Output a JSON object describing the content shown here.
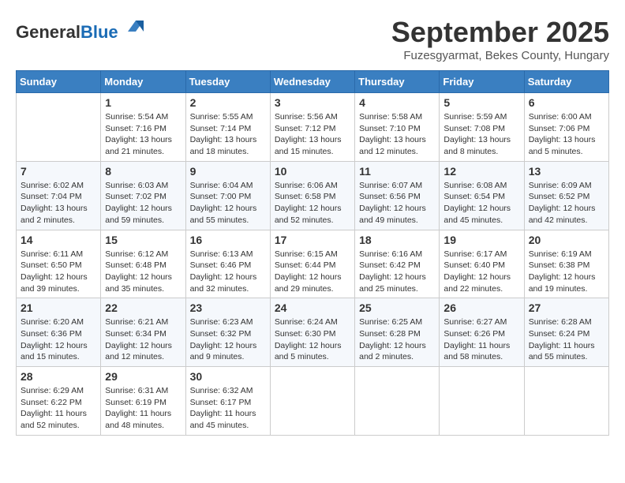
{
  "header": {
    "logo_general": "General",
    "logo_blue": "Blue",
    "month": "September 2025",
    "location": "Fuzesgyarmat, Bekes County, Hungary"
  },
  "calendar": {
    "days_of_week": [
      "Sunday",
      "Monday",
      "Tuesday",
      "Wednesday",
      "Thursday",
      "Friday",
      "Saturday"
    ],
    "weeks": [
      [
        {
          "day": "",
          "sunrise": "",
          "sunset": "",
          "daylight": ""
        },
        {
          "day": "1",
          "sunrise": "Sunrise: 5:54 AM",
          "sunset": "Sunset: 7:16 PM",
          "daylight": "Daylight: 13 hours and 21 minutes."
        },
        {
          "day": "2",
          "sunrise": "Sunrise: 5:55 AM",
          "sunset": "Sunset: 7:14 PM",
          "daylight": "Daylight: 13 hours and 18 minutes."
        },
        {
          "day": "3",
          "sunrise": "Sunrise: 5:56 AM",
          "sunset": "Sunset: 7:12 PM",
          "daylight": "Daylight: 13 hours and 15 minutes."
        },
        {
          "day": "4",
          "sunrise": "Sunrise: 5:58 AM",
          "sunset": "Sunset: 7:10 PM",
          "daylight": "Daylight: 13 hours and 12 minutes."
        },
        {
          "day": "5",
          "sunrise": "Sunrise: 5:59 AM",
          "sunset": "Sunset: 7:08 PM",
          "daylight": "Daylight: 13 hours and 8 minutes."
        },
        {
          "day": "6",
          "sunrise": "Sunrise: 6:00 AM",
          "sunset": "Sunset: 7:06 PM",
          "daylight": "Daylight: 13 hours and 5 minutes."
        }
      ],
      [
        {
          "day": "7",
          "sunrise": "Sunrise: 6:02 AM",
          "sunset": "Sunset: 7:04 PM",
          "daylight": "Daylight: 13 hours and 2 minutes."
        },
        {
          "day": "8",
          "sunrise": "Sunrise: 6:03 AM",
          "sunset": "Sunset: 7:02 PM",
          "daylight": "Daylight: 12 hours and 59 minutes."
        },
        {
          "day": "9",
          "sunrise": "Sunrise: 6:04 AM",
          "sunset": "Sunset: 7:00 PM",
          "daylight": "Daylight: 12 hours and 55 minutes."
        },
        {
          "day": "10",
          "sunrise": "Sunrise: 6:06 AM",
          "sunset": "Sunset: 6:58 PM",
          "daylight": "Daylight: 12 hours and 52 minutes."
        },
        {
          "day": "11",
          "sunrise": "Sunrise: 6:07 AM",
          "sunset": "Sunset: 6:56 PM",
          "daylight": "Daylight: 12 hours and 49 minutes."
        },
        {
          "day": "12",
          "sunrise": "Sunrise: 6:08 AM",
          "sunset": "Sunset: 6:54 PM",
          "daylight": "Daylight: 12 hours and 45 minutes."
        },
        {
          "day": "13",
          "sunrise": "Sunrise: 6:09 AM",
          "sunset": "Sunset: 6:52 PM",
          "daylight": "Daylight: 12 hours and 42 minutes."
        }
      ],
      [
        {
          "day": "14",
          "sunrise": "Sunrise: 6:11 AM",
          "sunset": "Sunset: 6:50 PM",
          "daylight": "Daylight: 12 hours and 39 minutes."
        },
        {
          "day": "15",
          "sunrise": "Sunrise: 6:12 AM",
          "sunset": "Sunset: 6:48 PM",
          "daylight": "Daylight: 12 hours and 35 minutes."
        },
        {
          "day": "16",
          "sunrise": "Sunrise: 6:13 AM",
          "sunset": "Sunset: 6:46 PM",
          "daylight": "Daylight: 12 hours and 32 minutes."
        },
        {
          "day": "17",
          "sunrise": "Sunrise: 6:15 AM",
          "sunset": "Sunset: 6:44 PM",
          "daylight": "Daylight: 12 hours and 29 minutes."
        },
        {
          "day": "18",
          "sunrise": "Sunrise: 6:16 AM",
          "sunset": "Sunset: 6:42 PM",
          "daylight": "Daylight: 12 hours and 25 minutes."
        },
        {
          "day": "19",
          "sunrise": "Sunrise: 6:17 AM",
          "sunset": "Sunset: 6:40 PM",
          "daylight": "Daylight: 12 hours and 22 minutes."
        },
        {
          "day": "20",
          "sunrise": "Sunrise: 6:19 AM",
          "sunset": "Sunset: 6:38 PM",
          "daylight": "Daylight: 12 hours and 19 minutes."
        }
      ],
      [
        {
          "day": "21",
          "sunrise": "Sunrise: 6:20 AM",
          "sunset": "Sunset: 6:36 PM",
          "daylight": "Daylight: 12 hours and 15 minutes."
        },
        {
          "day": "22",
          "sunrise": "Sunrise: 6:21 AM",
          "sunset": "Sunset: 6:34 PM",
          "daylight": "Daylight: 12 hours and 12 minutes."
        },
        {
          "day": "23",
          "sunrise": "Sunrise: 6:23 AM",
          "sunset": "Sunset: 6:32 PM",
          "daylight": "Daylight: 12 hours and 9 minutes."
        },
        {
          "day": "24",
          "sunrise": "Sunrise: 6:24 AM",
          "sunset": "Sunset: 6:30 PM",
          "daylight": "Daylight: 12 hours and 5 minutes."
        },
        {
          "day": "25",
          "sunrise": "Sunrise: 6:25 AM",
          "sunset": "Sunset: 6:28 PM",
          "daylight": "Daylight: 12 hours and 2 minutes."
        },
        {
          "day": "26",
          "sunrise": "Sunrise: 6:27 AM",
          "sunset": "Sunset: 6:26 PM",
          "daylight": "Daylight: 11 hours and 58 minutes."
        },
        {
          "day": "27",
          "sunrise": "Sunrise: 6:28 AM",
          "sunset": "Sunset: 6:24 PM",
          "daylight": "Daylight: 11 hours and 55 minutes."
        }
      ],
      [
        {
          "day": "28",
          "sunrise": "Sunrise: 6:29 AM",
          "sunset": "Sunset: 6:22 PM",
          "daylight": "Daylight: 11 hours and 52 minutes."
        },
        {
          "day": "29",
          "sunrise": "Sunrise: 6:31 AM",
          "sunset": "Sunset: 6:19 PM",
          "daylight": "Daylight: 11 hours and 48 minutes."
        },
        {
          "day": "30",
          "sunrise": "Sunrise: 6:32 AM",
          "sunset": "Sunset: 6:17 PM",
          "daylight": "Daylight: 11 hours and 45 minutes."
        },
        {
          "day": "",
          "sunrise": "",
          "sunset": "",
          "daylight": ""
        },
        {
          "day": "",
          "sunrise": "",
          "sunset": "",
          "daylight": ""
        },
        {
          "day": "",
          "sunrise": "",
          "sunset": "",
          "daylight": ""
        },
        {
          "day": "",
          "sunrise": "",
          "sunset": "",
          "daylight": ""
        }
      ]
    ]
  }
}
